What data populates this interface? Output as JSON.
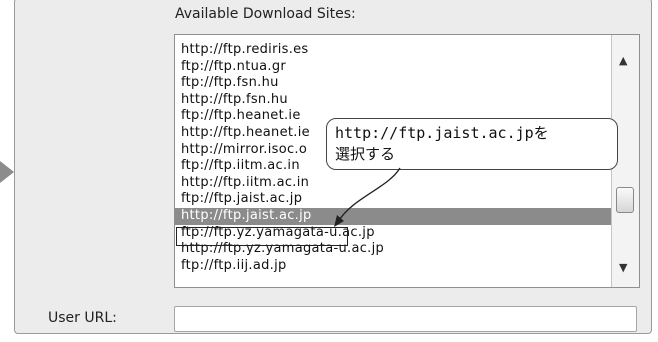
{
  "download_sites": {
    "label": "Available Download Sites:",
    "items": [
      "http://ftp.rediris.es",
      "ftp://ftp.ntua.gr",
      "ftp://ftp.fsn.hu",
      "http://ftp.fsn.hu",
      "ftp://ftp.heanet.ie",
      "http://ftp.heanet.ie",
      "http://mirror.isoc.o",
      "ftp://ftp.iitm.ac.in",
      "http://ftp.iitm.ac.in",
      "ftp://ftp.jaist.ac.jp",
      "http://ftp.jaist.ac.jp",
      "ftp://ftp.yz.yamagata-u.ac.jp",
      "http://ftp.yz.yamagata-u.ac.jp",
      "ftp://ftp.iij.ad.jp"
    ],
    "selected_index": 10
  },
  "callout": {
    "line1": "http://ftp.jaist.ac.jpを",
    "line2": "選択する"
  },
  "user_url": {
    "label": "User URL:",
    "value": ""
  },
  "icons": {
    "scroll_up": "triangle-up",
    "scroll_down": "triangle-down",
    "left_arrow": "triangle-right"
  }
}
